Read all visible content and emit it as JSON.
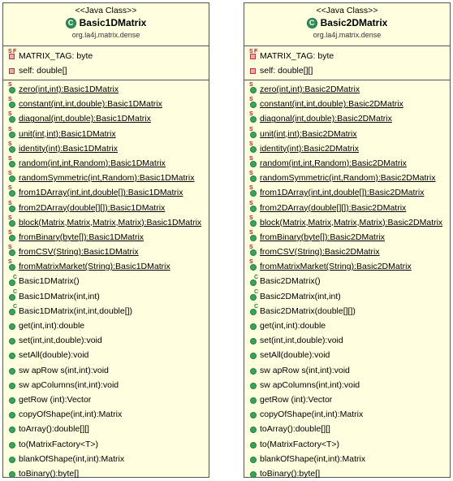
{
  "classes": [
    {
      "stereotype": "<<Java Class>>",
      "name": "Basic1DMatrix",
      "package": "org.la4j.matrix.dense",
      "fields": [
        {
          "text": "MATRIX_TAG: byte",
          "icon": "static-final-field-icon",
          "static": false
        },
        {
          "text": "self: double[]",
          "icon": "private-field-icon",
          "static": false
        }
      ],
      "methods": [
        {
          "text": "zero(int,int):Basic1DMatrix",
          "icon": "static-method-icon",
          "static": true
        },
        {
          "text": "constant(int,int,double):Basic1DMatrix",
          "icon": "static-method-icon",
          "static": true
        },
        {
          "text": "diagonal(int,double):Basic1DMatrix",
          "icon": "static-method-icon",
          "static": true
        },
        {
          "text": "unit(int,int):Basic1DMatrix",
          "icon": "static-method-icon",
          "static": true
        },
        {
          "text": "identity(int):Basic1DMatrix",
          "icon": "static-method-icon",
          "static": true
        },
        {
          "text": "random(int,int,Random):Basic1DMatrix",
          "icon": "static-method-icon",
          "static": true
        },
        {
          "text": "randomSymmetric(int,Random):Basic1DMatrix",
          "icon": "static-method-icon",
          "static": true
        },
        {
          "text": "from1DArray(int,int,double[]):Basic1DMatrix",
          "icon": "static-method-icon",
          "static": true
        },
        {
          "text": "from2DArray(double[][]):Basic1DMatrix",
          "icon": "static-method-icon",
          "static": true
        },
        {
          "text": "block(Matrix,Matrix,Matrix,Matrix):Basic1DMatrix",
          "icon": "static-method-icon",
          "static": true
        },
        {
          "text": "fromBinary(byte[]):Basic1DMatrix",
          "icon": "static-method-icon",
          "static": true
        },
        {
          "text": "fromCSV(String):Basic1DMatrix",
          "icon": "static-method-icon",
          "static": true
        },
        {
          "text": "fromMatrixMarket(String):Basic1DMatrix",
          "icon": "static-method-icon",
          "static": true
        },
        {
          "text": "Basic1DMatrix()",
          "icon": "constructor-icon",
          "static": false
        },
        {
          "text": "Basic1DMatrix(int,int)",
          "icon": "constructor-icon",
          "static": false
        },
        {
          "text": "Basic1DMatrix(int,int,double[])",
          "icon": "constructor-icon",
          "static": false
        },
        {
          "text": "get(int,int):double",
          "icon": "public-method-icon",
          "static": false
        },
        {
          "text": "set(int,int,double):void",
          "icon": "public-method-icon",
          "static": false
        },
        {
          "text": "setAll(double):void",
          "icon": "public-method-icon",
          "static": false
        },
        {
          "text": "sw apRow s(int,int):void",
          "icon": "public-method-icon",
          "static": false
        },
        {
          "text": "sw apColumns(int,int):void",
          "icon": "public-method-icon",
          "static": false
        },
        {
          "text": "getRow (int):Vector",
          "icon": "public-method-icon",
          "static": false
        },
        {
          "text": "copyOfShape(int,int):Matrix",
          "icon": "public-method-icon",
          "static": false
        },
        {
          "text": "toArray():double[][]",
          "icon": "public-method-icon",
          "static": false
        },
        {
          "text": "to(MatrixFactory<T>)",
          "icon": "public-method-icon",
          "static": false
        },
        {
          "text": "blankOfShape(int,int):Matrix",
          "icon": "public-method-icon",
          "static": false
        },
        {
          "text": "toBinary():byte[]",
          "icon": "public-method-icon",
          "static": false
        }
      ]
    },
    {
      "stereotype": "<<Java Class>>",
      "name": "Basic2DMatrix",
      "package": "org.la4j.matrix.dense",
      "fields": [
        {
          "text": "MATRIX_TAG: byte",
          "icon": "static-final-field-icon",
          "static": false
        },
        {
          "text": "self: double[][]",
          "icon": "private-field-icon",
          "static": false
        }
      ],
      "methods": [
        {
          "text": "zero(int,int):Basic2DMatrix",
          "icon": "static-method-icon",
          "static": true
        },
        {
          "text": "constant(int,int,double):Basic2DMatrix",
          "icon": "static-method-icon",
          "static": true
        },
        {
          "text": "diagonal(int,double):Basic2DMatrix",
          "icon": "static-method-icon",
          "static": true
        },
        {
          "text": "unit(int,int):Basic2DMatrix",
          "icon": "static-method-icon",
          "static": true
        },
        {
          "text": "identity(int):Basic2DMatrix",
          "icon": "static-method-icon",
          "static": true
        },
        {
          "text": "random(int,int,Random):Basic2DMatrix",
          "icon": "static-method-icon",
          "static": true
        },
        {
          "text": "randomSymmetric(int,Random):Basic2DMatrix",
          "icon": "static-method-icon",
          "static": true
        },
        {
          "text": "from1DArray(int,int,double[]):Basic2DMatrix",
          "icon": "static-method-icon",
          "static": true
        },
        {
          "text": "from2DArray(double[][]):Basic2DMatrix",
          "icon": "static-method-icon",
          "static": true
        },
        {
          "text": "block(Matrix,Matrix,Matrix,Matrix):Basic2DMatrix",
          "icon": "static-method-icon",
          "static": true
        },
        {
          "text": "fromBinary(byte[]):Basic2DMatrix",
          "icon": "static-method-icon",
          "static": true
        },
        {
          "text": "fromCSV(String):Basic2DMatrix",
          "icon": "static-method-icon",
          "static": true
        },
        {
          "text": "fromMatrixMarket(String):Basic2DMatrix",
          "icon": "static-method-icon",
          "static": true
        },
        {
          "text": "Basic2DMatrix()",
          "icon": "constructor-icon",
          "static": false
        },
        {
          "text": "Basic2DMatrix(int,int)",
          "icon": "constructor-icon",
          "static": false
        },
        {
          "text": "Basic2DMatrix(double[][])",
          "icon": "constructor-icon",
          "static": false
        },
        {
          "text": "get(int,int):double",
          "icon": "public-method-icon",
          "static": false
        },
        {
          "text": "set(int,int,double):void",
          "icon": "public-method-icon",
          "static": false
        },
        {
          "text": "setAll(double):void",
          "icon": "public-method-icon",
          "static": false
        },
        {
          "text": "sw apRow s(int,int):void",
          "icon": "public-method-icon",
          "static": false
        },
        {
          "text": "sw apColumns(int,int):void",
          "icon": "public-method-icon",
          "static": false
        },
        {
          "text": "getRow (int):Vector",
          "icon": "public-method-icon",
          "static": false
        },
        {
          "text": "copyOfShape(int,int):Matrix",
          "icon": "public-method-icon",
          "static": false
        },
        {
          "text": "toArray():double[][]",
          "icon": "public-method-icon",
          "static": false
        },
        {
          "text": "to(MatrixFactory<T>)",
          "icon": "public-method-icon",
          "static": false
        },
        {
          "text": "blankOfShape(int,int):Matrix",
          "icon": "public-method-icon",
          "static": false
        },
        {
          "text": "toBinary():byte[]",
          "icon": "public-method-icon",
          "static": false
        }
      ]
    }
  ]
}
